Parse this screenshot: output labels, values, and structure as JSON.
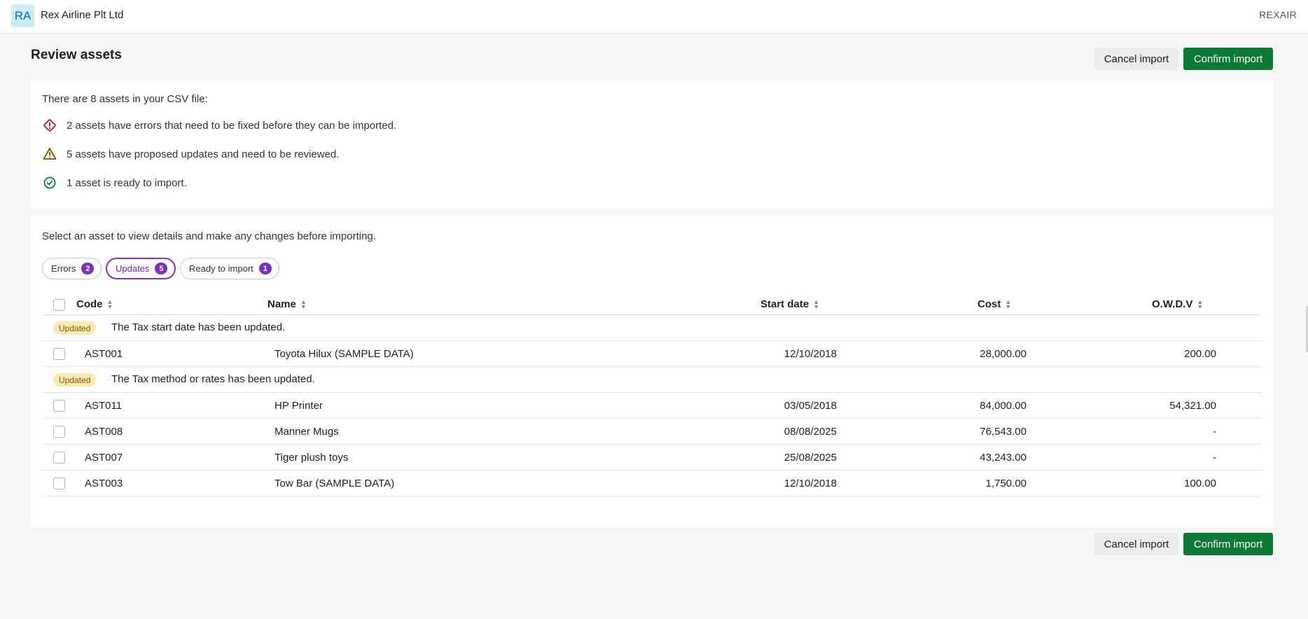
{
  "org": {
    "avatar_initials": "RA",
    "name": "Rex Airline Plt Ltd",
    "code": "REXAIR"
  },
  "page": {
    "title": "Review assets"
  },
  "actions": {
    "cancel_label": "Cancel import",
    "confirm_label": "Confirm import"
  },
  "summary": {
    "intro": "There are 8 assets in your CSV file:",
    "errors_text": "2 assets have errors that need to be fixed before they can be imported.",
    "updates_text": "5 assets have proposed updates and need to be reviewed.",
    "ready_text": "1 asset is ready to import."
  },
  "list": {
    "instructions": "Select an asset to view details and make any changes before importing.",
    "filters": [
      {
        "label": "Errors",
        "count": "2"
      },
      {
        "label": "Updates",
        "count": "5"
      },
      {
        "label": "Ready to import",
        "count": "1"
      }
    ],
    "active_filter": "Updates",
    "columns": {
      "code": "Code",
      "name": "Name",
      "start_date": "Start date",
      "cost": "Cost",
      "owdv": "O.W.D.V"
    },
    "groups": [
      {
        "badge": "Updated",
        "message": "The Tax start date has been updated.",
        "rows": [
          {
            "code": "AST001",
            "name": "Toyota Hilux (SAMPLE DATA)",
            "start_date": "12/10/2018",
            "cost": "28,000.00",
            "owdv": "200.00"
          }
        ]
      },
      {
        "badge": "Updated",
        "message": "The Tax method or rates has been updated.",
        "rows": [
          {
            "code": "AST011",
            "name": "HP Printer",
            "start_date": "03/05/2018",
            "cost": "84,000.00",
            "owdv": "54,321.00"
          },
          {
            "code": "AST008",
            "name": "Manner Mugs",
            "start_date": "08/08/2025",
            "cost": "76,543.00",
            "owdv": "-"
          },
          {
            "code": "AST007",
            "name": "Tiger plush toys",
            "start_date": "25/08/2025",
            "cost": "43,243.00",
            "owdv": "-"
          },
          {
            "code": "AST003",
            "name": "Tow Bar (SAMPLE DATA)",
            "start_date": "12/10/2018",
            "cost": "1,750.00",
            "owdv": "100.00"
          }
        ]
      }
    ]
  },
  "colors": {
    "primary": "#0b7a36",
    "accent": "#7d2fc4",
    "error": "#c0262d",
    "warning": "#7a5a00",
    "success": "#0b7a36"
  },
  "icons": {
    "errors": "error-diamond-icon",
    "updates": "warning-triangle-icon",
    "ready": "check-circle-icon",
    "sort": "sort-icon"
  }
}
